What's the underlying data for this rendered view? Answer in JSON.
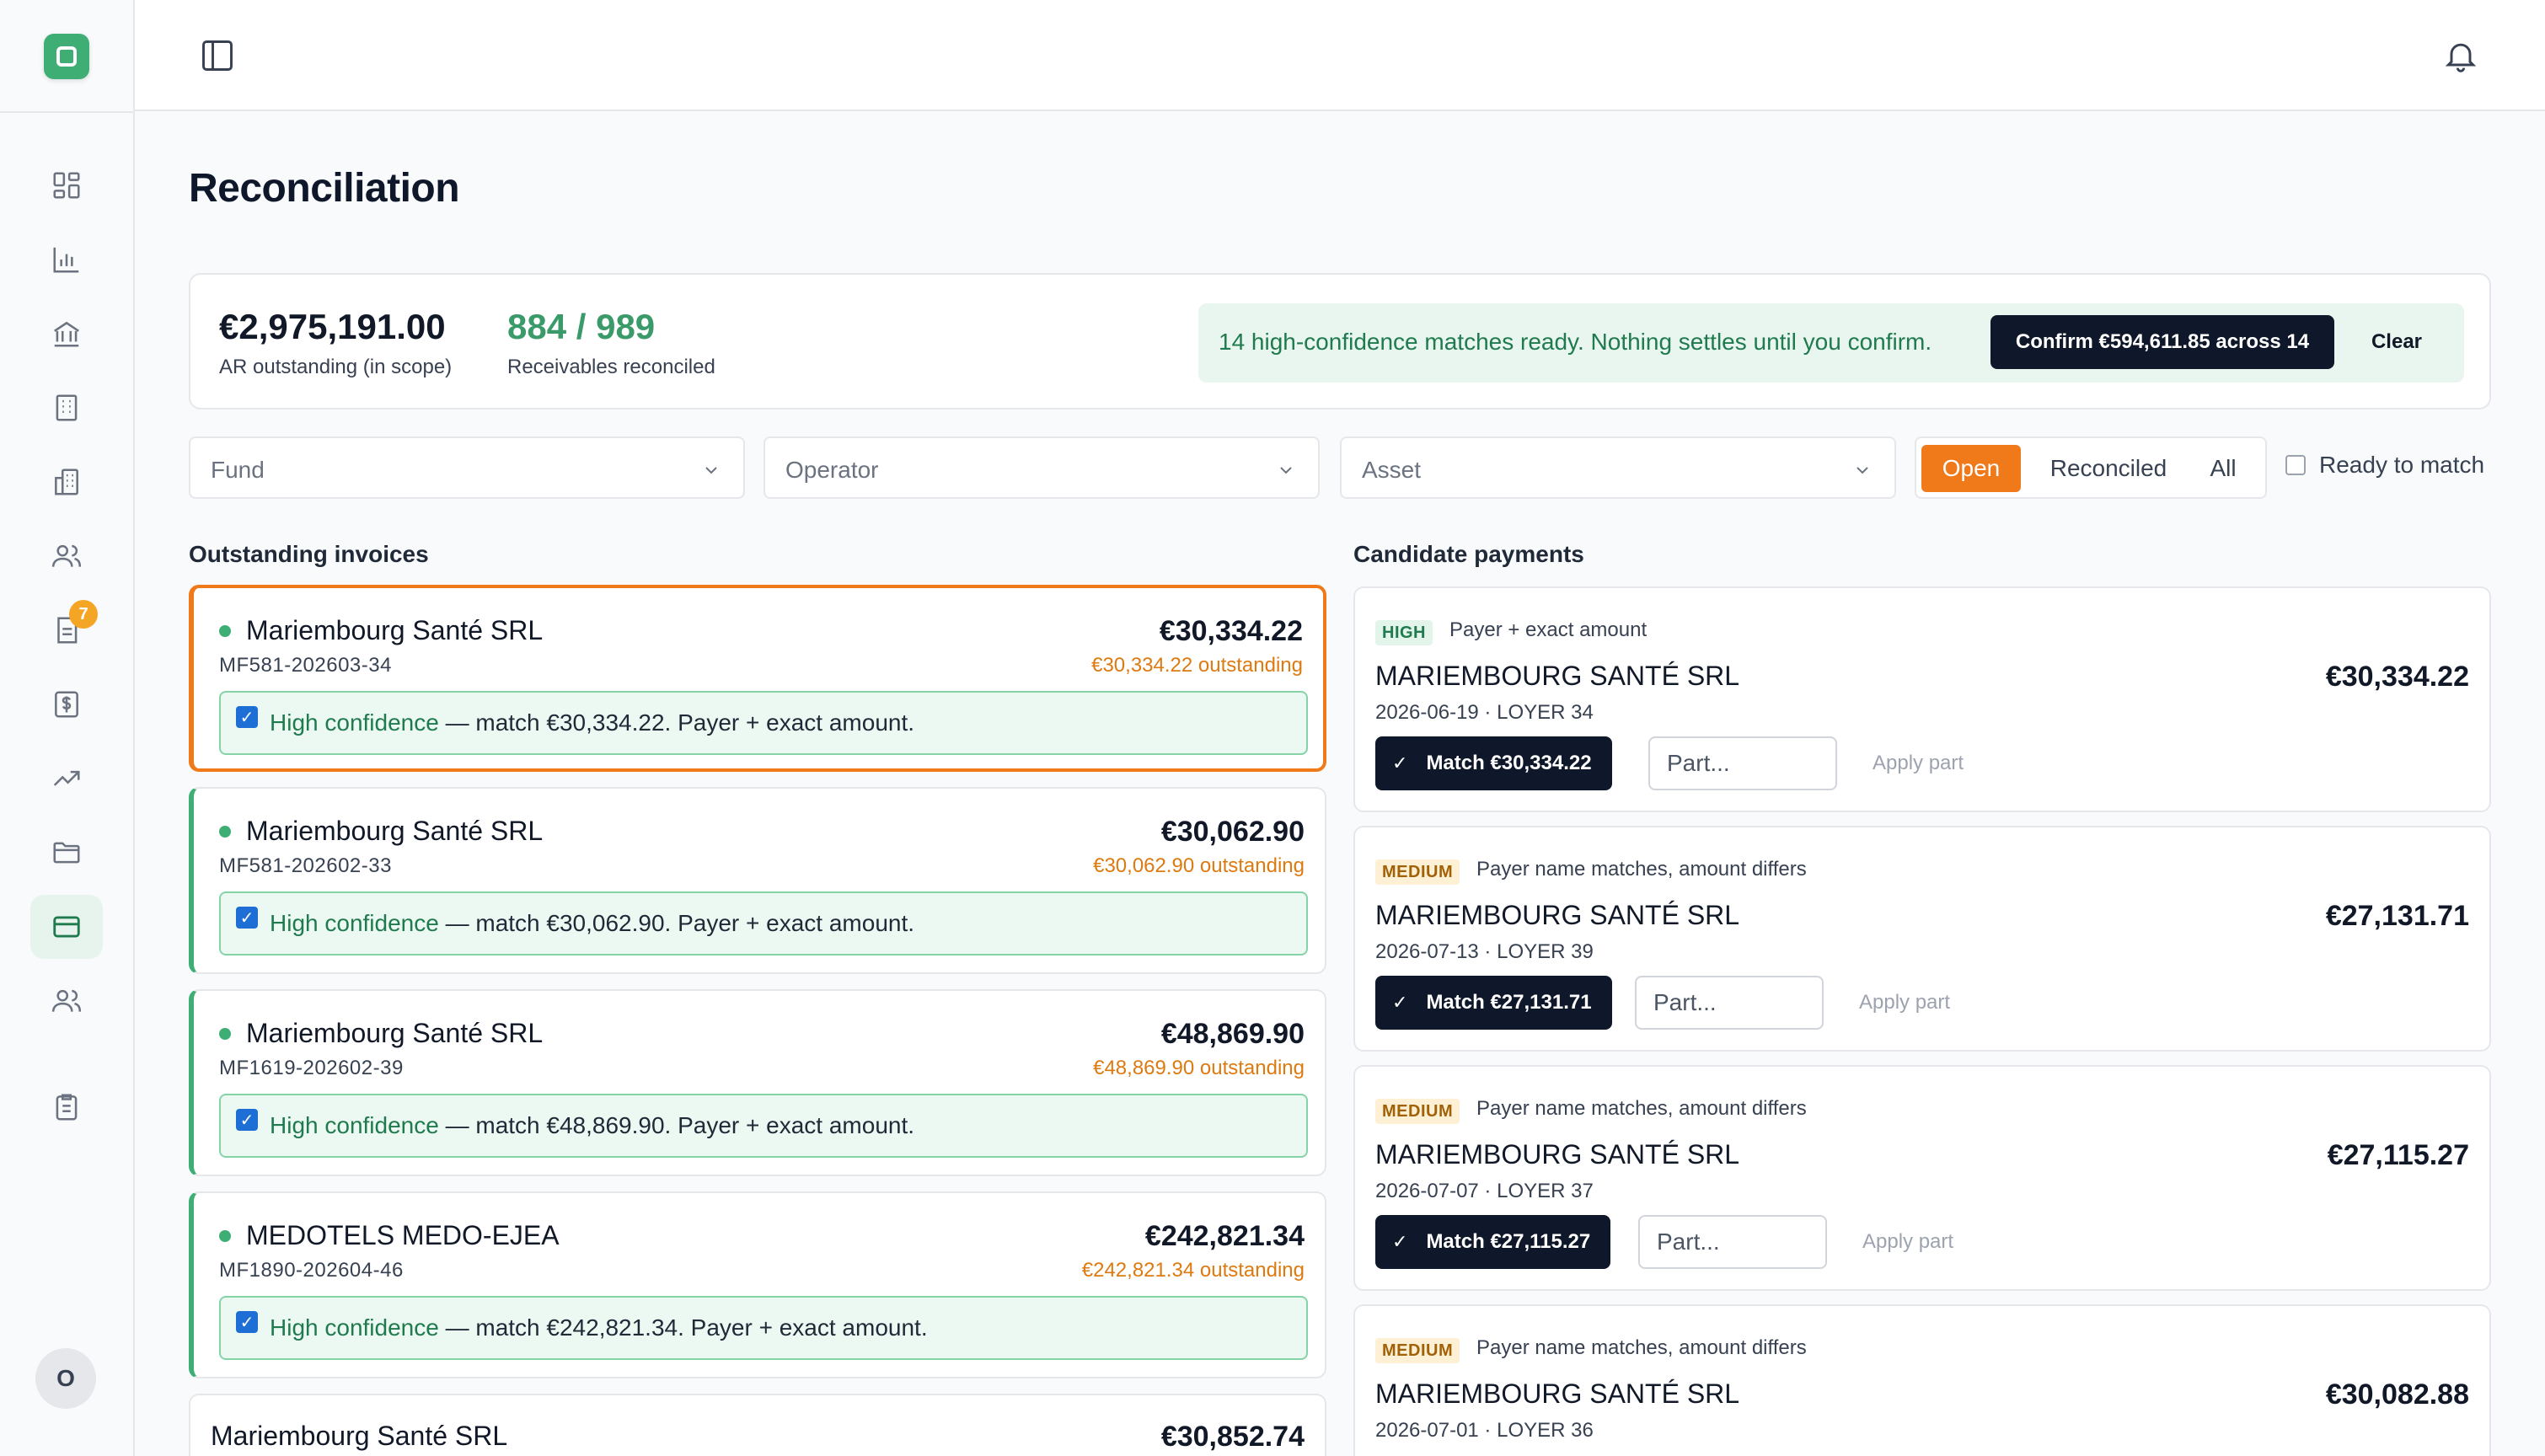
{
  "app": {
    "notifications_label": "",
    "nav_badge": "7",
    "avatar_initial": "O"
  },
  "page": {
    "title": "Reconciliation"
  },
  "summary": {
    "ar_outstanding": "€2,975,191.00",
    "ar_outstanding_label": "AR outstanding (in scope)",
    "reconciled": "884 / 989",
    "reconciled_label": "Receivables reconciled",
    "notice": "14 high-confidence matches ready. Nothing settles until you confirm.",
    "confirm_label": "Confirm €594,611.85 across 14",
    "clear_label": "Clear"
  },
  "filters": {
    "fund": "Fund",
    "operator": "Operator",
    "asset": "Asset",
    "status_tabs": [
      "Open",
      "Reconciled",
      "All"
    ],
    "active_tab": "Open",
    "ready_label": "Ready to match"
  },
  "invoices": {
    "heading": "Outstanding invoices",
    "items": [
      {
        "name": "Mariembourg Santé SRL",
        "ref": "MF581-202603-34",
        "amount": "€30,334.22",
        "outstanding": "€30,334.22 outstanding",
        "hint_strong": "High confidence",
        "hint_rest": " — match €30,334.22. Payer + exact amount."
      },
      {
        "name": "Mariembourg Santé SRL",
        "ref": "MF581-202602-33",
        "amount": "€30,062.90",
        "outstanding": "€30,062.90 outstanding",
        "hint_strong": "High confidence",
        "hint_rest": " — match €30,062.90. Payer + exact amount."
      },
      {
        "name": "Mariembourg Santé SRL",
        "ref": "MF1619-202602-39",
        "amount": "€48,869.90",
        "outstanding": "€48,869.90 outstanding",
        "hint_strong": "High confidence",
        "hint_rest": " — match €48,869.90. Payer + exact amount."
      },
      {
        "name": "MEDOTELS MEDO-EJEA",
        "ref": "MF1890-202604-46",
        "amount": "€242,821.34",
        "outstanding": "€242,821.34 outstanding",
        "hint_strong": "High confidence",
        "hint_rest": " — match €242,821.34. Payer + exact amount."
      },
      {
        "name": "Mariembourg Santé SRL",
        "amount": "€30,852.74"
      }
    ]
  },
  "payments": {
    "heading": "Candidate payments",
    "part_placeholder": "Part...",
    "apply_label": "Apply part",
    "items": [
      {
        "badge": "HIGH",
        "reason": "Payer + exact amount",
        "payer": "MARIEMBOURG SANTÉ SRL",
        "meta": "2026-06-19 · LOYER 34",
        "amount": "€30,334.22",
        "match": "Match €30,334.22"
      },
      {
        "badge": "MEDIUM",
        "reason": "Payer name matches, amount differs",
        "payer": "MARIEMBOURG SANTÉ SRL",
        "meta": "2026-07-13 · LOYER 39",
        "amount": "€27,131.71",
        "match": "Match €27,131.71"
      },
      {
        "badge": "MEDIUM",
        "reason": "Payer name matches, amount differs",
        "payer": "MARIEMBOURG SANTÉ SRL",
        "meta": "2026-07-07 · LOYER 37",
        "amount": "€27,115.27",
        "match": "Match €27,115.27"
      },
      {
        "badge": "MEDIUM",
        "reason": "Payer name matches, amount differs",
        "payer": "MARIEMBOURG SANTÉ SRL",
        "meta": "2026-07-01 · LOYER 36",
        "amount": "€30,082.88"
      }
    ]
  },
  "colors": {
    "accent_green": "#3fae75",
    "accent_orange": "#f0791a",
    "dark": "#0f172a"
  }
}
